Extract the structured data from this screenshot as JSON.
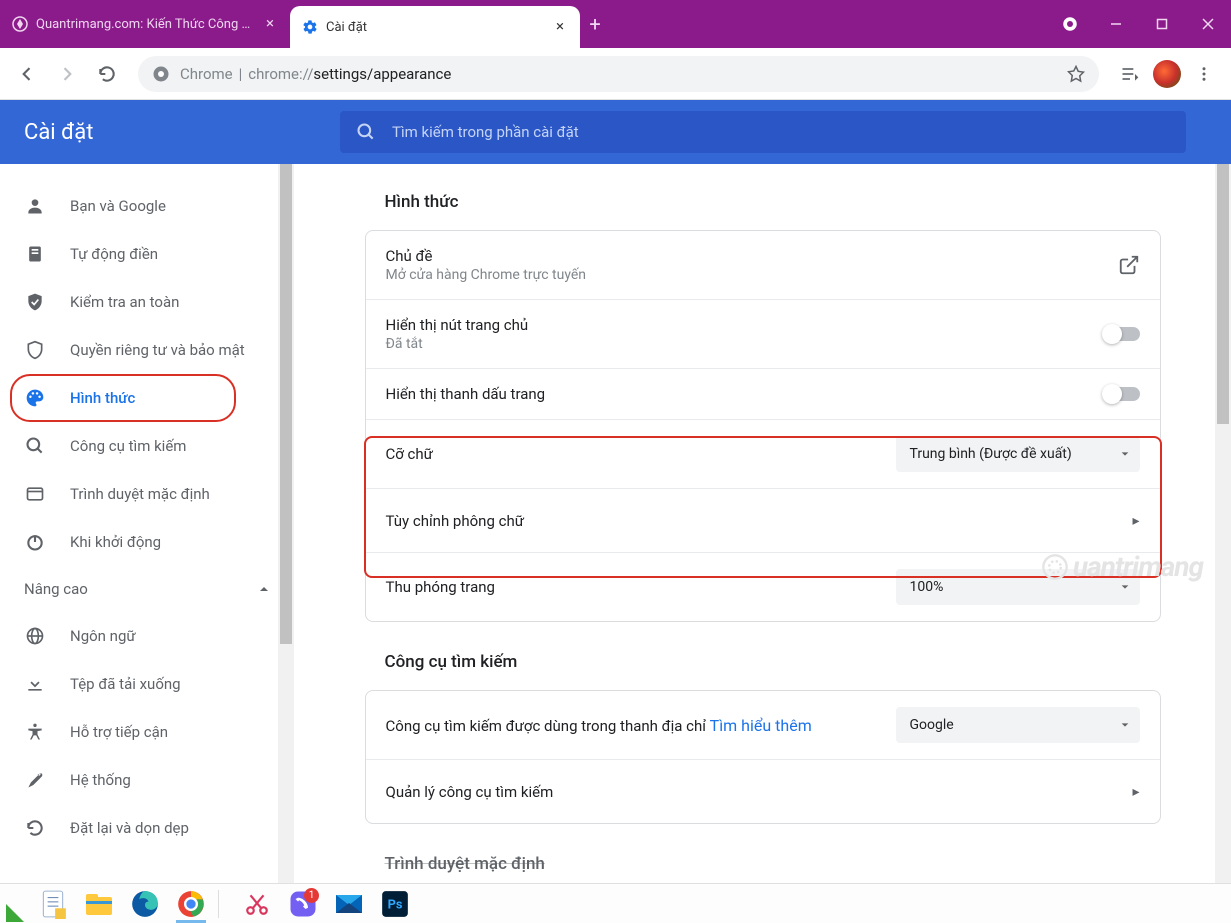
{
  "titlebar": {
    "tabs": [
      {
        "title": "Quantrimang.com: Kiến Thức Công Nghệ",
        "favicon": "quantrimang-icon"
      },
      {
        "title": "Cài đặt",
        "favicon": "gear-icon"
      }
    ],
    "new_tab": "+"
  },
  "toolbar": {
    "url_prefix": "Chrome",
    "url_sep": "|",
    "url_host": "chrome://",
    "url_path_gray": "settings/",
    "url_path_dark": "appearance"
  },
  "settings_header": {
    "title": "Cài đặt",
    "search_placeholder": "Tìm kiếm trong phần cài đặt"
  },
  "sidebar": {
    "items": [
      {
        "icon": "person-icon",
        "label": "Bạn và Google"
      },
      {
        "icon": "autofill-icon",
        "label": "Tự động điền"
      },
      {
        "icon": "shield-check-icon",
        "label": "Kiểm tra an toàn"
      },
      {
        "icon": "security-icon",
        "label": "Quyền riêng tư và bảo mật"
      },
      {
        "icon": "palette-icon",
        "label": "Hình thức",
        "active": true
      },
      {
        "icon": "search-icon",
        "label": "Công cụ tìm kiếm"
      },
      {
        "icon": "default-browser-icon",
        "label": "Trình duyệt mặc định"
      },
      {
        "icon": "power-icon",
        "label": "Khi khởi động"
      }
    ],
    "advanced_label": "Nâng cao",
    "advanced_items": [
      {
        "icon": "globe-icon",
        "label": "Ngôn ngữ"
      },
      {
        "icon": "download-icon",
        "label": "Tệp đã tải xuống"
      },
      {
        "icon": "accessibility-icon",
        "label": "Hỗ trợ tiếp cận"
      },
      {
        "icon": "wrench-icon",
        "label": "Hệ thống"
      },
      {
        "icon": "reset-icon",
        "label": "Đặt lại và dọn dẹp"
      }
    ]
  },
  "main": {
    "section1_title": "Hình thức",
    "theme": {
      "label": "Chủ đề",
      "sub": "Mở cửa hàng Chrome trực tuyến"
    },
    "home_button": {
      "label": "Hiển thị nút trang chủ",
      "sub": "Đã tắt"
    },
    "bookmarks_bar": {
      "label": "Hiển thị thanh dấu trang"
    },
    "font_size": {
      "label": "Cỡ chữ",
      "value": "Trung bình (Được đề xuất)"
    },
    "custom_fonts": {
      "label": "Tùy chỉnh phông chữ"
    },
    "page_zoom": {
      "label": "Thu phóng trang",
      "value": "100%"
    },
    "section2_title": "Công cụ tìm kiếm",
    "search_engine": {
      "label": "Công cụ tìm kiếm được dùng trong thanh địa chỉ ",
      "link": "Tìm hiểu thêm",
      "value": "Google"
    },
    "manage_search": {
      "label": "Quản lý công cụ tìm kiếm"
    },
    "section3_title_truncated": "Trình duyệt mặc định"
  },
  "watermark": "uantrimang",
  "taskbar": {
    "viber_badge": "1"
  }
}
